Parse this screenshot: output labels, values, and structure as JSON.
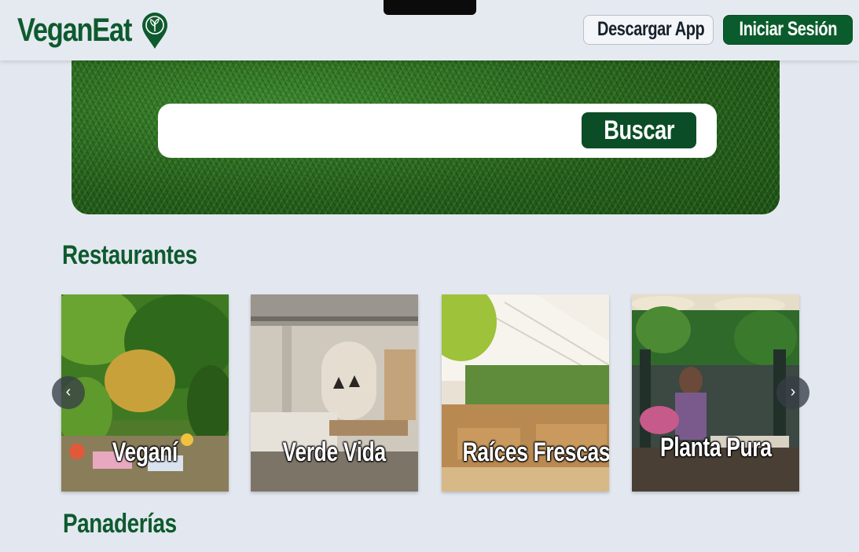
{
  "header": {
    "logo": "VeganEat",
    "download_label": "Descargar App",
    "login_label": "Iniciar Sesión"
  },
  "hero": {
    "search_placeholder": "",
    "search_button": "Buscar"
  },
  "sections": {
    "restaurants_title": "Restaurantes",
    "bakeries_title": "Panaderías"
  },
  "restaurants": [
    {
      "name": "Veganí"
    },
    {
      "name": "Verde Vida"
    },
    {
      "name": "Raíces Frescas"
    },
    {
      "name": "Planta Pura"
    }
  ],
  "carousel": {
    "prev_glyph": "‹",
    "next_glyph": "›"
  },
  "colors": {
    "brand_green": "#0e5a2e",
    "button_green": "#0b5c2c",
    "page_bg": "#e3e8f0"
  }
}
